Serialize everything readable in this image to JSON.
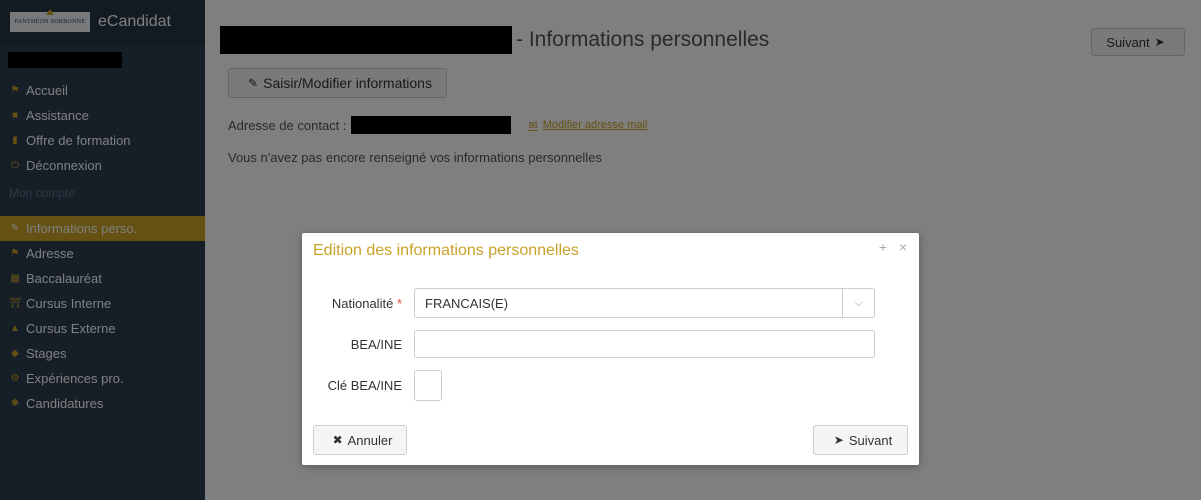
{
  "sidebar": {
    "logo_text": "PANTHÉON SORBONNE",
    "app_name": "eCandidat",
    "items": [
      {
        "label": "Accueil",
        "icon": "home-icon"
      },
      {
        "label": "Assistance",
        "icon": "ticket-icon"
      },
      {
        "label": "Offre de formation",
        "icon": "bookmark-icon"
      },
      {
        "label": "Déconnexion",
        "icon": "power-icon"
      }
    ],
    "section_label": "Mon compte",
    "account_items": [
      {
        "label": "Informations perso.",
        "icon": "pencil-icon",
        "active": true
      },
      {
        "label": "Adresse",
        "icon": "home-icon"
      },
      {
        "label": "Baccalauréat",
        "icon": "book-icon"
      },
      {
        "label": "Cursus Interne",
        "icon": "institution-icon"
      },
      {
        "label": "Cursus Externe",
        "icon": "graduation-cap-icon"
      },
      {
        "label": "Stages",
        "icon": "cube-icon"
      },
      {
        "label": "Expériences pro.",
        "icon": "cogs-icon"
      },
      {
        "label": "Candidatures",
        "icon": "asterisk-icon"
      }
    ]
  },
  "main": {
    "title": "- Informations personnelles",
    "next_top_label": "Suivant",
    "edit_button_label": "Saisir/Modifier informations",
    "contact_label": "Adresse de contact :",
    "modify_mail_label": "Modifier adresse mail",
    "info_text": "Vous n'avez pas encore renseigné vos informations personnelles"
  },
  "dialog": {
    "title": "Edition des informations personnelles",
    "maximize_glyph": "+",
    "close_glyph": "×",
    "nationality_label": "Nationalité",
    "required_mark": "*",
    "nationality_value": "FRANCAIS(E)",
    "bea_label": "BEA/INE",
    "bea_value": "",
    "cle_label": "Clé BEA/INE",
    "cle_value": "",
    "cancel_label": "Annuler",
    "next_label": "Suivant"
  },
  "colors": {
    "accent": "#c9a227",
    "sidebar_bg": "#2c3e50"
  }
}
